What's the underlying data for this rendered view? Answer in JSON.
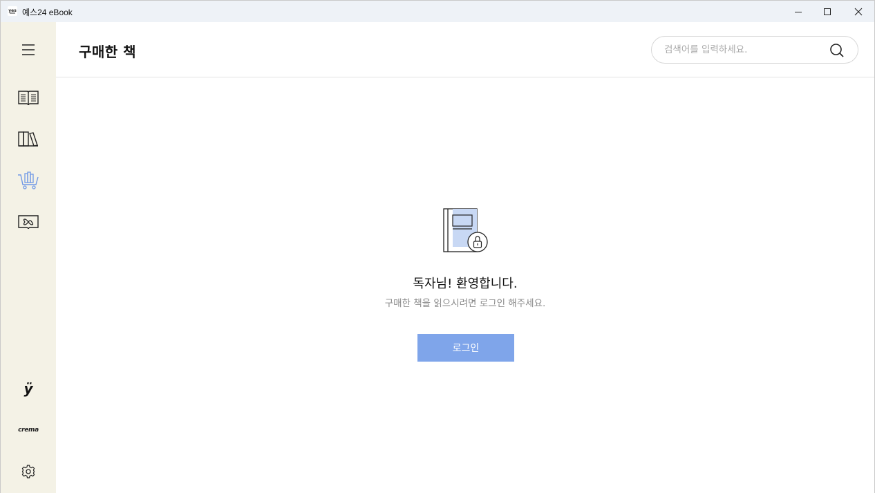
{
  "window": {
    "title": "예스24 eBook",
    "logo_icon": "yes24-logo-icon",
    "controls": [
      "minimize-icon",
      "maximize-icon",
      "close-icon"
    ]
  },
  "sidebar": {
    "items": [
      {
        "icon": "menu-icon"
      },
      {
        "icon": "open-book-icon"
      },
      {
        "icon": "bookshelf-icon"
      },
      {
        "icon": "cart-books-icon",
        "active": true
      },
      {
        "icon": "unlimited-book-icon"
      }
    ],
    "bottom": [
      {
        "icon": "yes24-y-logo-icon",
        "label": "ÿ"
      },
      {
        "icon": "crema-logo-icon",
        "label": "crema"
      },
      {
        "icon": "gear-icon"
      }
    ],
    "active_color": "#6f98e6"
  },
  "header": {
    "title": "구매한 책",
    "search": {
      "placeholder": "검색어를 입력하세요.",
      "value": ""
    }
  },
  "main": {
    "illustration": "locked-book-icon",
    "welcome_title": "독자님! 환영합니다.",
    "welcome_sub": "구매한 책을 읽으시려면 로그인 해주세요.",
    "login_label": "로그인"
  },
  "colors": {
    "sidebar_bg": "#f4f2e6",
    "titlebar_bg": "#eef2f7",
    "accent": "#7fa5ea"
  }
}
